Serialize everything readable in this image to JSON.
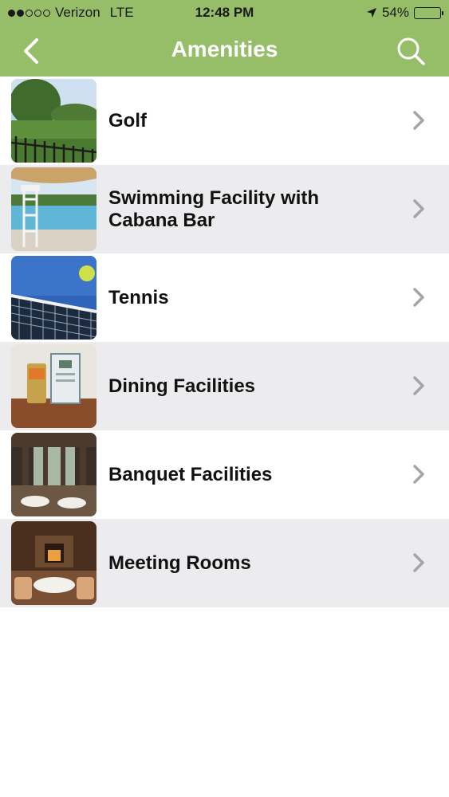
{
  "status_bar": {
    "carrier": "Verizon",
    "network": "LTE",
    "time": "12:48 PM",
    "battery": "54%",
    "battery_level": 0.54,
    "signal_bars_filled": 2,
    "signal_bars_total": 5
  },
  "nav": {
    "title": "Amenities",
    "back_icon": "chevron-left-icon",
    "search_icon": "search-icon"
  },
  "colors": {
    "nav_background": "#96bd68",
    "row_alt_background": "#ececef"
  },
  "amenities": [
    {
      "label": "Golf",
      "image": "golf-course-photo"
    },
    {
      "label": "Swimming Facility with Cabana Bar",
      "image": "swimming-pool-photo"
    },
    {
      "label": "Tennis",
      "image": "tennis-net-ball-photo"
    },
    {
      "label": "Dining Facilities",
      "image": "dining-table-photo"
    },
    {
      "label": "Banquet Facilities",
      "image": "banquet-hall-photo"
    },
    {
      "label": "Meeting Rooms",
      "image": "meeting-room-photo"
    }
  ]
}
